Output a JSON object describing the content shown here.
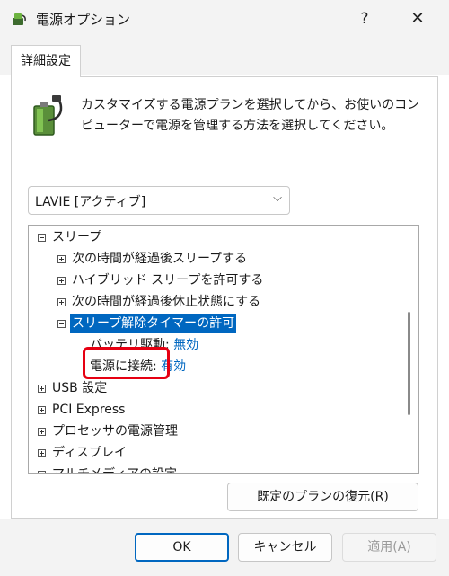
{
  "window": {
    "title": "電源オプション",
    "help_glyph": "?",
    "close_glyph": "✕"
  },
  "tab": {
    "label": "詳細設定"
  },
  "description": "カスタマイズする電源プランを選択してから、お使いのコンピューターで電源を管理する方法を選択してください。",
  "plan_select": {
    "value": "LAVIE [アクティブ]",
    "chevron": "⌵"
  },
  "tree": {
    "sleep": "スリープ",
    "sleep_after": "次の時間が経過後スリープする",
    "hybrid_sleep": "ハイブリッド スリープを許可する",
    "hibernate_after": "次の時間が経過後休止状態にする",
    "wake_timers": "スリープ解除タイマーの許可",
    "on_battery_label": "バッテリ駆動:",
    "on_battery_value": "無効",
    "plugged_in_label": "電源に接続:",
    "plugged_in_value": "有効",
    "usb": "USB 設定",
    "pci": "PCI Express",
    "processor": "プロセッサの電源管理",
    "display": "ディスプレイ",
    "multimedia": "マルチメディアの設定"
  },
  "buttons": {
    "restore": "既定のプランの復元(R)",
    "ok": "OK",
    "cancel": "キャンセル",
    "apply": "適用(A)"
  },
  "colors": {
    "accent": "#0067c0",
    "highlight": "#e60012"
  }
}
